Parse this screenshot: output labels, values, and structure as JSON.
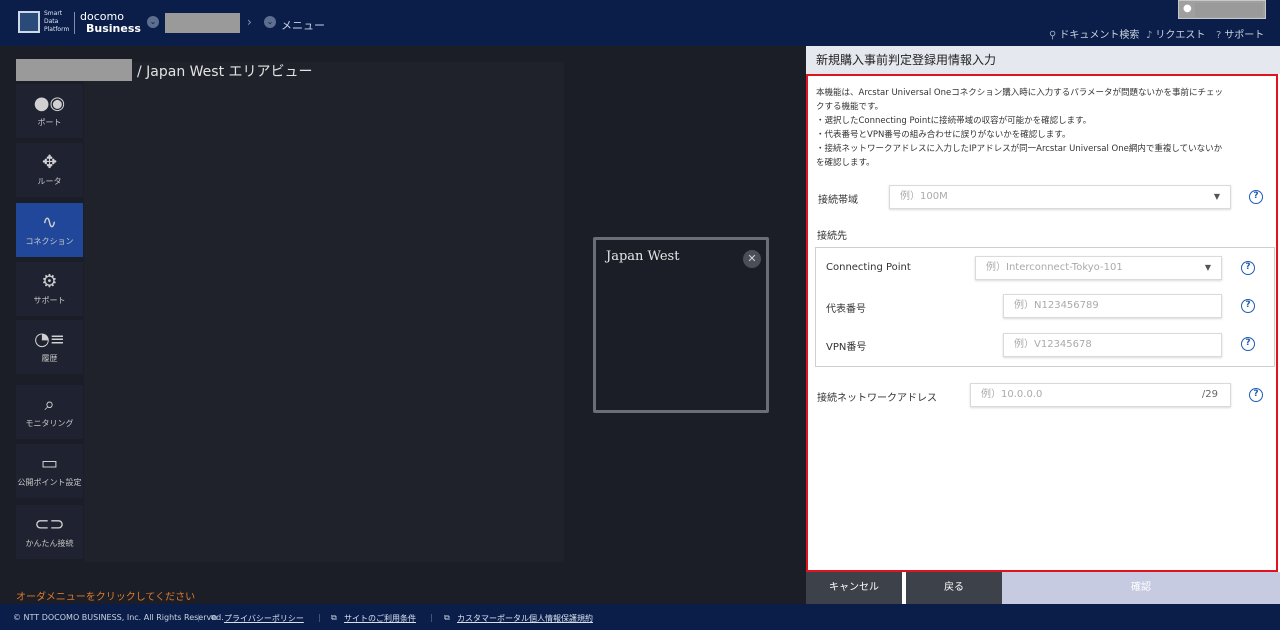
{
  "header": {
    "brand_small": [
      "Smart",
      "Data",
      "Platform"
    ],
    "brand_main": "docomo",
    "brand_sub": "Business",
    "menu_label": "メニュー",
    "links": [
      "ドキュメント検索",
      "リクエスト",
      "サポート"
    ]
  },
  "main": {
    "title": "/ Japan West エリアビュー",
    "order_hint": "オーダメニューをクリックしてください"
  },
  "sidebar": {
    "items": [
      {
        "label": "ポート",
        "icon": "port-icon"
      },
      {
        "label": "ルータ",
        "icon": "router-icon"
      },
      {
        "label": "コネクション",
        "icon": "connection-icon"
      },
      {
        "label": "サポート",
        "icon": "support-icon"
      },
      {
        "label": "履歴",
        "icon": "history-icon"
      },
      {
        "label": "モニタリング",
        "icon": "monitoring-icon"
      },
      {
        "label": "公開ポイント設定",
        "icon": "public-point-icon"
      },
      {
        "label": "かんたん接続",
        "icon": "easy-connect-icon"
      }
    ],
    "active_index": 2
  },
  "popup": {
    "title": "Japan West",
    "close": "✕"
  },
  "panel": {
    "title": "新規購入事前判定登録用情報入力",
    "description": [
      "本機能は、Arcstar Universal Oneコネクション購入時に入力するパラメータが問題ないかを事前にチェッ",
      "クする機能です。",
      "・選択したConnecting Pointに接続帯域の収容が可能かを確認します。",
      "・代表番号とVPN番号の組み合わせに誤りがないかを確認します。",
      "・接続ネットワークアドレスに入力したIPアドレスが同一Arcstar Universal One網内で重複していないか",
      "を確認します。"
    ],
    "bandwidth": {
      "label": "接続帯域",
      "placeholder": "例）100M"
    },
    "destination": {
      "label": "接続先"
    },
    "connecting_point": {
      "label": "Connecting Point",
      "placeholder": "例）Interconnect-Tokyo-101"
    },
    "rep_number": {
      "label": "代表番号",
      "placeholder": "例）N123456789"
    },
    "vpn_number": {
      "label": "VPN番号",
      "placeholder": "例）V12345678"
    },
    "network_address": {
      "label": "接続ネットワークアドレス",
      "placeholder": "例）10.0.0.0",
      "suffix": "/29"
    },
    "help": "?"
  },
  "buttons": {
    "cancel": "キャンセル",
    "back": "戻る",
    "confirm": "確認"
  },
  "footer": {
    "copyright": "© NTT DOCOMO BUSINESS, Inc. All Rights Reserved.",
    "links": [
      "プライバシーポリシー",
      "サイトのご利用条件",
      "カスタマーポータル個人情報保護規約"
    ]
  },
  "colors": {
    "header_bg": "#0b1e4a",
    "accent": "#21479a",
    "alert_frame": "#e0141e",
    "help_icon": "#1e5bb5"
  }
}
